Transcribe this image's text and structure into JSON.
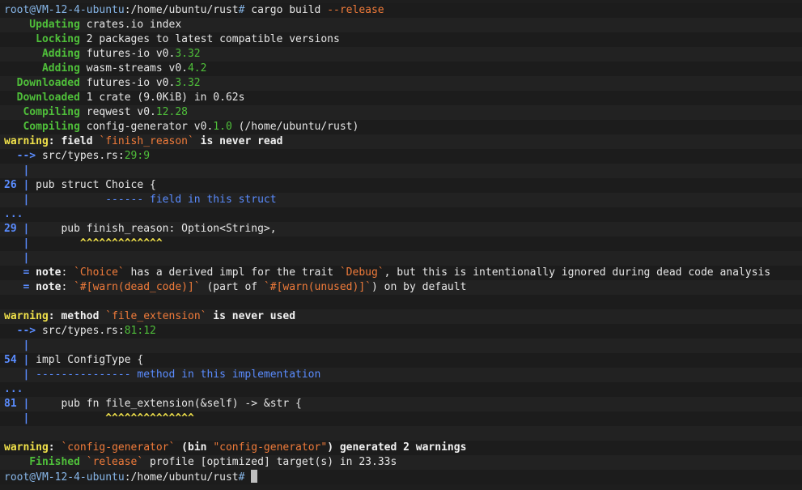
{
  "colors": {
    "default": "#e6e6e6",
    "prompt": "#87b6e8",
    "green": "#4fbf3a",
    "orange": "#f07b3a",
    "yellow": "#f0e14a",
    "blue": "#5a8cff",
    "bold_white": "#f2f2f2"
  },
  "terminal": {
    "lines": [
      {
        "tokens": [
          {
            "t": "root@VM-12-4-ubuntu",
            "c": "prompt"
          },
          {
            "t": ":/home/ubuntu/rust",
            "c": "default"
          },
          {
            "t": "# ",
            "c": "prompt"
          },
          {
            "t": "cargo build ",
            "c": "default"
          },
          {
            "t": "--release",
            "c": "orange"
          }
        ]
      },
      {
        "tokens": [
          {
            "t": "    Updating ",
            "c": "green",
            "b": true
          },
          {
            "t": "crates.io index",
            "c": "default"
          }
        ]
      },
      {
        "tokens": [
          {
            "t": "     Locking ",
            "c": "green",
            "b": true
          },
          {
            "t": "2 packages to latest compatible versions",
            "c": "default"
          }
        ]
      },
      {
        "tokens": [
          {
            "t": "      Adding ",
            "c": "green",
            "b": true
          },
          {
            "t": "futures-io v0.",
            "c": "default"
          },
          {
            "t": "3.32",
            "c": "green"
          }
        ]
      },
      {
        "tokens": [
          {
            "t": "      Adding ",
            "c": "green",
            "b": true
          },
          {
            "t": "wasm-streams v0.",
            "c": "default"
          },
          {
            "t": "4.2",
            "c": "green"
          }
        ]
      },
      {
        "tokens": [
          {
            "t": "  Downloaded ",
            "c": "green",
            "b": true
          },
          {
            "t": "futures-io v0.",
            "c": "default"
          },
          {
            "t": "3.32",
            "c": "green"
          }
        ]
      },
      {
        "tokens": [
          {
            "t": "  Downloaded ",
            "c": "green",
            "b": true
          },
          {
            "t": "1 crate (",
            "c": "default"
          },
          {
            "t": "9.0KiB",
            "c": "default"
          },
          {
            "t": ") in 0.62s",
            "c": "default"
          }
        ]
      },
      {
        "tokens": [
          {
            "t": "   Compiling ",
            "c": "green",
            "b": true
          },
          {
            "t": "reqwest v0.",
            "c": "default"
          },
          {
            "t": "12.28",
            "c": "green"
          }
        ]
      },
      {
        "tokens": [
          {
            "t": "   Compiling ",
            "c": "green",
            "b": true
          },
          {
            "t": "config-generator v0.",
            "c": "default"
          },
          {
            "t": "1.0",
            "c": "green"
          },
          {
            "t": " (/home/ubuntu/rust)",
            "c": "default"
          }
        ]
      },
      {
        "tokens": [
          {
            "t": "warning",
            "c": "yellow",
            "b": true
          },
          {
            "t": ": field ",
            "c": "bold_white",
            "b": true
          },
          {
            "t": "`finish_reason`",
            "c": "orange"
          },
          {
            "t": " is never read",
            "c": "bold_white",
            "b": true
          }
        ]
      },
      {
        "tokens": [
          {
            "t": "  --> ",
            "c": "blue",
            "b": true
          },
          {
            "t": "src/types.rs:",
            "c": "default"
          },
          {
            "t": "29:9",
            "c": "green"
          }
        ]
      },
      {
        "tokens": [
          {
            "t": "   |",
            "c": "blue",
            "b": true
          }
        ]
      },
      {
        "tokens": [
          {
            "t": "26 | ",
            "c": "blue",
            "b": true
          },
          {
            "t": "pub struct Choice {",
            "c": "default"
          }
        ]
      },
      {
        "tokens": [
          {
            "t": "   |",
            "c": "blue",
            "b": true
          },
          {
            "t": "            ------ field in this struct",
            "c": "blue"
          }
        ]
      },
      {
        "tokens": [
          {
            "t": "...",
            "c": "blue",
            "b": true
          }
        ]
      },
      {
        "tokens": [
          {
            "t": "29 | ",
            "c": "blue",
            "b": true
          },
          {
            "t": "    pub finish_reason: Option<String>,",
            "c": "default"
          }
        ]
      },
      {
        "tokens": [
          {
            "t": "   |",
            "c": "blue",
            "b": true
          },
          {
            "t": "        ^^^^^^^^^^^^^",
            "c": "yellow",
            "b": true
          }
        ]
      },
      {
        "tokens": [
          {
            "t": "   |",
            "c": "blue",
            "b": true
          }
        ]
      },
      {
        "tokens": [
          {
            "t": "   = ",
            "c": "blue",
            "b": true
          },
          {
            "t": "note",
            "c": "bold_white",
            "b": true
          },
          {
            "t": ": ",
            "c": "default"
          },
          {
            "t": "`Choice`",
            "c": "orange"
          },
          {
            "t": " has a derived impl for the trait ",
            "c": "default"
          },
          {
            "t": "`Debug`",
            "c": "orange"
          },
          {
            "t": ", but this is intentionally ignored during dead code analysis",
            "c": "default"
          }
        ]
      },
      {
        "tokens": [
          {
            "t": "   = ",
            "c": "blue",
            "b": true
          },
          {
            "t": "note",
            "c": "bold_white",
            "b": true
          },
          {
            "t": ": ",
            "c": "default"
          },
          {
            "t": "`#[warn(dead_code)]`",
            "c": "orange"
          },
          {
            "t": " (part of ",
            "c": "default"
          },
          {
            "t": "`#[warn(unused)]`",
            "c": "orange"
          },
          {
            "t": ") on by default",
            "c": "default"
          }
        ]
      },
      {
        "tokens": [
          {
            "t": "",
            "c": "default"
          }
        ]
      },
      {
        "tokens": [
          {
            "t": "warning",
            "c": "yellow",
            "b": true
          },
          {
            "t": ": method ",
            "c": "bold_white",
            "b": true
          },
          {
            "t": "`file_extension`",
            "c": "orange"
          },
          {
            "t": " is never used",
            "c": "bold_white",
            "b": true
          }
        ]
      },
      {
        "tokens": [
          {
            "t": "  --> ",
            "c": "blue",
            "b": true
          },
          {
            "t": "src/types.rs:",
            "c": "default"
          },
          {
            "t": "81:12",
            "c": "green"
          }
        ]
      },
      {
        "tokens": [
          {
            "t": "   |",
            "c": "blue",
            "b": true
          }
        ]
      },
      {
        "tokens": [
          {
            "t": "54 | ",
            "c": "blue",
            "b": true
          },
          {
            "t": "impl ConfigType {",
            "c": "default"
          }
        ]
      },
      {
        "tokens": [
          {
            "t": "   |",
            "c": "blue",
            "b": true
          },
          {
            "t": " --------------- method in this implementation",
            "c": "blue"
          }
        ]
      },
      {
        "tokens": [
          {
            "t": "...",
            "c": "blue",
            "b": true
          }
        ]
      },
      {
        "tokens": [
          {
            "t": "81 | ",
            "c": "blue",
            "b": true
          },
          {
            "t": "    pub fn file_extension(&self) -> &str {",
            "c": "default"
          }
        ]
      },
      {
        "tokens": [
          {
            "t": "   |",
            "c": "blue",
            "b": true
          },
          {
            "t": "            ^^^^^^^^^^^^^^",
            "c": "yellow",
            "b": true
          }
        ]
      },
      {
        "tokens": [
          {
            "t": "",
            "c": "default"
          }
        ]
      },
      {
        "tokens": [
          {
            "t": "warning",
            "c": "yellow",
            "b": true
          },
          {
            "t": ": ",
            "c": "bold_white",
            "b": true
          },
          {
            "t": "`config-generator`",
            "c": "orange"
          },
          {
            "t": " (bin ",
            "c": "bold_white",
            "b": true
          },
          {
            "t": "\"config-generator\"",
            "c": "orange"
          },
          {
            "t": ") generated 2 warnings",
            "c": "bold_white",
            "b": true
          }
        ]
      },
      {
        "tokens": [
          {
            "t": "    Finished ",
            "c": "green",
            "b": true
          },
          {
            "t": "`release`",
            "c": "orange"
          },
          {
            "t": " profile [",
            "c": "default"
          },
          {
            "t": "optimized",
            "c": "default"
          },
          {
            "t": "] target(s) in 23.33s",
            "c": "default"
          }
        ]
      },
      {
        "tokens": [
          {
            "t": "root@VM-12-4-ubuntu",
            "c": "prompt"
          },
          {
            "t": ":/home/ubuntu/rust",
            "c": "default"
          },
          {
            "t": "# ",
            "c": "prompt"
          }
        ],
        "cursor": true
      }
    ]
  }
}
